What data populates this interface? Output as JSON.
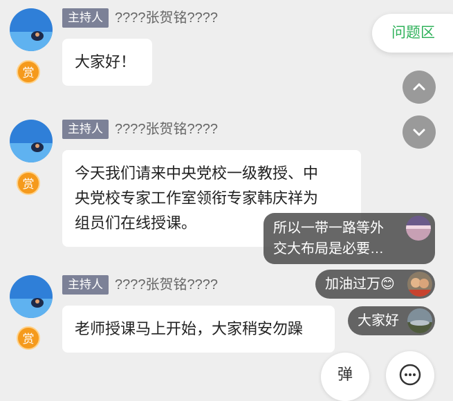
{
  "messages": [
    {
      "host_tag": "主持人",
      "sender": "????张贺铭????",
      "text_lines": [
        "大家好！"
      ],
      "reward_label": "赏"
    },
    {
      "host_tag": "主持人",
      "sender": "????张贺铭????",
      "text_lines": [
        "今天我们请来中央党校一级教授、中",
        "央党校专家工作室领衔专家韩庆祥为",
        "组员们在线授课。"
      ],
      "reward_label": "赏"
    },
    {
      "host_tag": "主持人",
      "sender": "????张贺铭????",
      "text_lines": [
        "老师授课马上开始，大家稍安勿躁"
      ],
      "reward_label": "赏"
    }
  ],
  "question_tab": "问题区",
  "danmaku": [
    {
      "lines": [
        "所以一带一路等外",
        "交大布局是必要…"
      ]
    },
    {
      "lines": [
        "加油过万😊"
      ]
    },
    {
      "lines": [
        "大家好"
      ]
    }
  ],
  "bottom_buttons": {
    "danmaku_toggle": "弹",
    "more_icon": "more-icon"
  },
  "colors": {
    "host_tag_bg": "#7c8197",
    "question_tab_text": "#2fb15a",
    "reward_badge": "#f59a1c",
    "danmaku_bg": "#464646"
  }
}
